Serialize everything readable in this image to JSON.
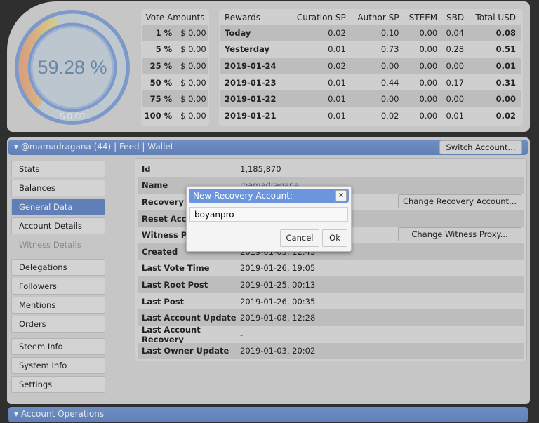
{
  "gauge": {
    "percent": "59.28 %",
    "value": "$ 0.00",
    "fill": 0.5928
  },
  "vote_amounts": {
    "header": "Vote Amounts",
    "rows": [
      [
        "1 %",
        "$ 0.00"
      ],
      [
        "5 %",
        "$ 0.00"
      ],
      [
        "25 %",
        "$ 0.00"
      ],
      [
        "50 %",
        "$ 0.00"
      ],
      [
        "75 %",
        "$ 0.00"
      ],
      [
        "100 %",
        "$ 0.00"
      ]
    ]
  },
  "rewards": {
    "headers": [
      "Rewards",
      "Curation SP",
      "Author SP",
      "STEEM",
      "SBD",
      "Total USD"
    ],
    "rows": [
      [
        "Today",
        "0.02",
        "0.10",
        "0.00",
        "0.04",
        "0.08"
      ],
      [
        "Yesterday",
        "0.01",
        "0.73",
        "0.00",
        "0.28",
        "0.51"
      ],
      [
        "2019-01-24",
        "0.02",
        "0.00",
        "0.00",
        "0.00",
        "0.01"
      ],
      [
        "2019-01-23",
        "0.01",
        "0.44",
        "0.00",
        "0.17",
        "0.31"
      ],
      [
        "2019-01-22",
        "0.01",
        "0.00",
        "0.00",
        "0.00",
        "0.00"
      ],
      [
        "2019-01-21",
        "0.01",
        "0.02",
        "0.00",
        "0.01",
        "0.02"
      ]
    ]
  },
  "header": {
    "account": "@mamadragana (44)",
    "sep": "|",
    "feed": "Feed",
    "wallet": "Wallet",
    "switch": "Switch Account..."
  },
  "sidebar": {
    "items": [
      "Stats",
      "Balances",
      "General Data",
      "Account Details",
      "Witness Details",
      "Delegations",
      "Followers",
      "Mentions",
      "Orders",
      "Steem Info",
      "System Info",
      "Settings"
    ]
  },
  "general": {
    "rows": [
      [
        "Id",
        "1,185,870"
      ],
      [
        "Name",
        "mamadragana"
      ],
      [
        "Recovery Account",
        ""
      ],
      [
        "Reset Account",
        ""
      ],
      [
        "Witness Proxy",
        ""
      ],
      [
        "Created",
        "2019-01-03, 12:43"
      ],
      [
        "Last Vote Time",
        "2019-01-26, 19:05"
      ],
      [
        "Last Root Post",
        "2019-01-25, 00:13"
      ],
      [
        "Last Post",
        "2019-01-26, 00:35"
      ],
      [
        "Last Account Update",
        "2019-01-08, 12:28"
      ],
      [
        "Last Account Recovery",
        "-"
      ],
      [
        "Last Owner Update",
        "2019-01-03, 20:02"
      ]
    ],
    "change_recovery": "Change Recovery Account...",
    "change_proxy": "Change Witness Proxy..."
  },
  "operations": {
    "title": "Account Operations"
  },
  "dialog": {
    "title": "New Recovery Account:",
    "close": "×",
    "input": "boyanpro",
    "cancel": "Cancel",
    "ok": "Ok"
  }
}
